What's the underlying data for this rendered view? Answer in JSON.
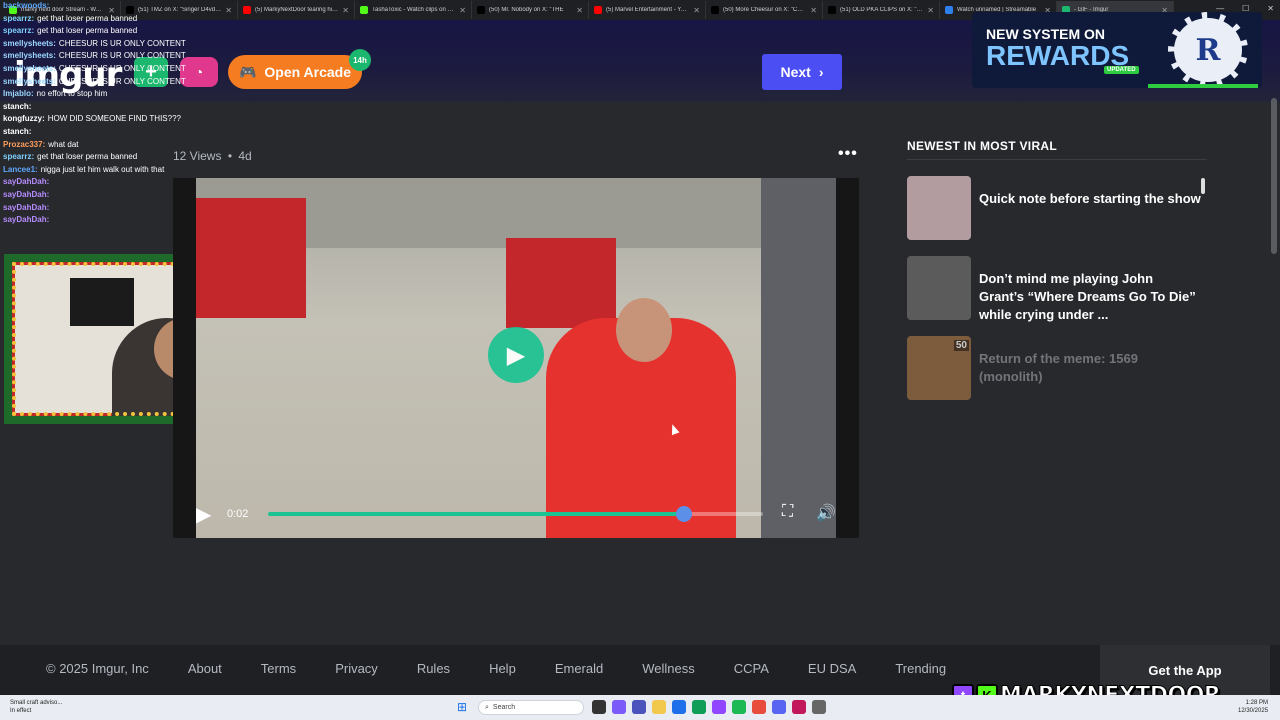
{
  "browser": {
    "tabs": [
      {
        "label": "marky next door Stream - Watch",
        "color": "#53fc18"
      },
      {
        "label": "(51) TMZ on X: \"Singer D4vd wil",
        "color": "#000000"
      },
      {
        "label": "(5) MarkyNextDoor tearing his A",
        "color": "#ff0000"
      },
      {
        "label": "TashaToxic - Watch clips on Kick",
        "color": "#53fc18"
      },
      {
        "label": "(50) Mr. Nobody on X: \"THE",
        "color": "#000000"
      },
      {
        "label": "(5) Marvel Entertainment - YouTu",
        "color": "#ff0000"
      },
      {
        "label": "(50) More Cheesur on X: \"Chees",
        "color": "#000000"
      },
      {
        "label": "(51) OLD PKA CLIPS on X: \"kk ex",
        "color": "#000000"
      },
      {
        "label": "Watch unnamed | Streamable",
        "color": "#2f80ed"
      },
      {
        "label": "- GIF - Imgur",
        "color": "#1bb76e"
      }
    ]
  },
  "header": {
    "logo": "imgur",
    "new_post_icon": "+",
    "arcade_label": "Open Arcade",
    "arcade_badge": "14h",
    "next_label": "Next"
  },
  "rewards": {
    "line1": "NEW SYSTEM ON",
    "line2": "REWARDS",
    "tag": "UPDATED",
    "chip_letter": "R"
  },
  "chat": [
    {
      "user": "backwoods:",
      "text": "",
      "color": "#5fa8ff"
    },
    {
      "user": "spearrz:",
      "text": "get that loser perma banned",
      "color": "#7fd1ff"
    },
    {
      "user": "spearrz:",
      "text": "get that loser perma banned",
      "color": "#7fd1ff"
    },
    {
      "user": "smellysheets:",
      "text": "CHEESUR IS UR ONLY CONTENT",
      "color": "#9bd7ff"
    },
    {
      "user": "smellysheets:",
      "text": "CHEESUR IS UR ONLY CONTENT",
      "color": "#9bd7ff"
    },
    {
      "user": "smellysheets:",
      "text": "CHEESUR IS UR ONLY CONTENT",
      "color": "#9bd7ff"
    },
    {
      "user": "smellysheets:",
      "text": "CHEESUR IS UR ONLY CONTENT",
      "color": "#9bd7ff"
    },
    {
      "user": "Imjablo:",
      "text": "no effort to stop him",
      "color": "#9bd7ff"
    },
    {
      "user": "stanch:",
      "text": "",
      "color": "#ffffff"
    },
    {
      "user": "kongfuzzy:",
      "text": "HOW DID SOMEONE FIND THIS???",
      "color": "#ffffff"
    },
    {
      "user": "stanch:",
      "text": "",
      "color": "#ffffff"
    },
    {
      "user": "Prozac337:",
      "text": "what dat",
      "color": "#ff9d5c"
    },
    {
      "user": "spearrz:",
      "text": "get that loser perma banned",
      "color": "#7fd1ff"
    },
    {
      "user": "Lancee1:",
      "text": "nigga just let him walk out with that",
      "color": "#5fa8ff"
    },
    {
      "user": "sayDahDah:",
      "text": "",
      "color": "#b68cff"
    },
    {
      "user": "sayDahDah:",
      "text": "",
      "color": "#b68cff"
    },
    {
      "user": "sayDahDah:",
      "text": "",
      "color": "#b68cff"
    },
    {
      "user": "sayDahDah:",
      "text": "",
      "color": "#b68cff"
    }
  ],
  "post": {
    "views": "12 Views",
    "separator": "•",
    "age": "4d",
    "more_icon": "•••"
  },
  "video": {
    "time": "0:02",
    "progress": 0.84
  },
  "sidebar": {
    "title": "NEWEST IN MOST VIRAL",
    "items": [
      {
        "title": "Quick note before starting the show",
        "thumb_color": "#b39ca0",
        "badge": ""
      },
      {
        "title": "Don’t mind me playing John Grant’s “Where Dreams Go To Die” while crying under ...",
        "thumb_color": "#5b5b5b",
        "badge": ""
      },
      {
        "title": "Return of the meme: 1569 (monolith)",
        "thumb_color": "#9a6c43",
        "badge": "50"
      }
    ]
  },
  "footer": {
    "links": [
      "© 2025 Imgur, Inc",
      "About",
      "Terms",
      "Privacy",
      "Rules",
      "Help",
      "Emerald",
      "Wellness",
      "CCPA",
      "EU DSA",
      "Trending"
    ],
    "get_app": "Get the App"
  },
  "streamer": {
    "twitch_icon": "t",
    "kick_icon": "K",
    "name": "MARKYNEXTDOOR"
  },
  "taskbar": {
    "notif_title": "Small craft adviso...",
    "notif_sub": "In effect",
    "search_label": "Search",
    "time": "1:28 PM",
    "date": "12/30/2025"
  }
}
